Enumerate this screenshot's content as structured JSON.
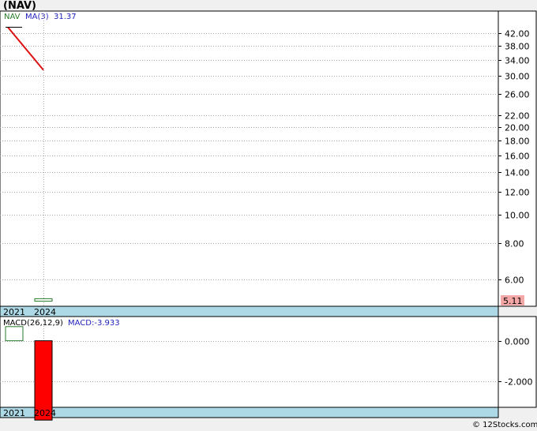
{
  "chart_data": [
    {
      "type": "candlestick",
      "title": "(NAV)",
      "legend": {
        "symbol": "NAV",
        "ma_label": "MA(3)",
        "ma_value": "31.37"
      },
      "yscale": "log",
      "ylim": [
        4.85,
        50
      ],
      "yticks": [
        "42.00",
        "38.00",
        "34.00",
        "30.00",
        "26.00",
        "22.00",
        "20.00",
        "18.00",
        "16.00",
        "14.00",
        "12.00",
        "10.00",
        "8.00",
        "6.00"
      ],
      "ytick_values": [
        42,
        38,
        34,
        30,
        26,
        22,
        20,
        18,
        16,
        14,
        12,
        10,
        8,
        6
      ],
      "last_price_label": "5.11",
      "last_price": 5.11,
      "x": [
        "2021",
        "2024"
      ],
      "candles": [
        {
          "x": "2024",
          "open": 5.05,
          "close": 5.15,
          "high": 5.15,
          "low": 5.05
        }
      ],
      "ma_line": {
        "x": [
          "2021",
          "2024"
        ],
        "values": [
          44.0,
          31.37
        ]
      },
      "colors": {
        "up": "#2a7a2a",
        "down": "#ff0000",
        "ma": "#dd1111",
        "last_bg": "#f4a7a7"
      }
    },
    {
      "type": "bar",
      "title": "MACD(26,12,9)",
      "macd_label": "MACD:-3.933",
      "ylim": [
        -3.3,
        1.2
      ],
      "yticks": [
        "0.000",
        "-2.000"
      ],
      "ytick_values": [
        0,
        -2
      ],
      "x": [
        "2021",
        "2024"
      ],
      "values": [
        0.7,
        -3.933
      ],
      "colors": {
        "positive": "#2a7a2a",
        "negative": "#ff0000"
      }
    }
  ],
  "watermark": "© 12Stocks.com"
}
